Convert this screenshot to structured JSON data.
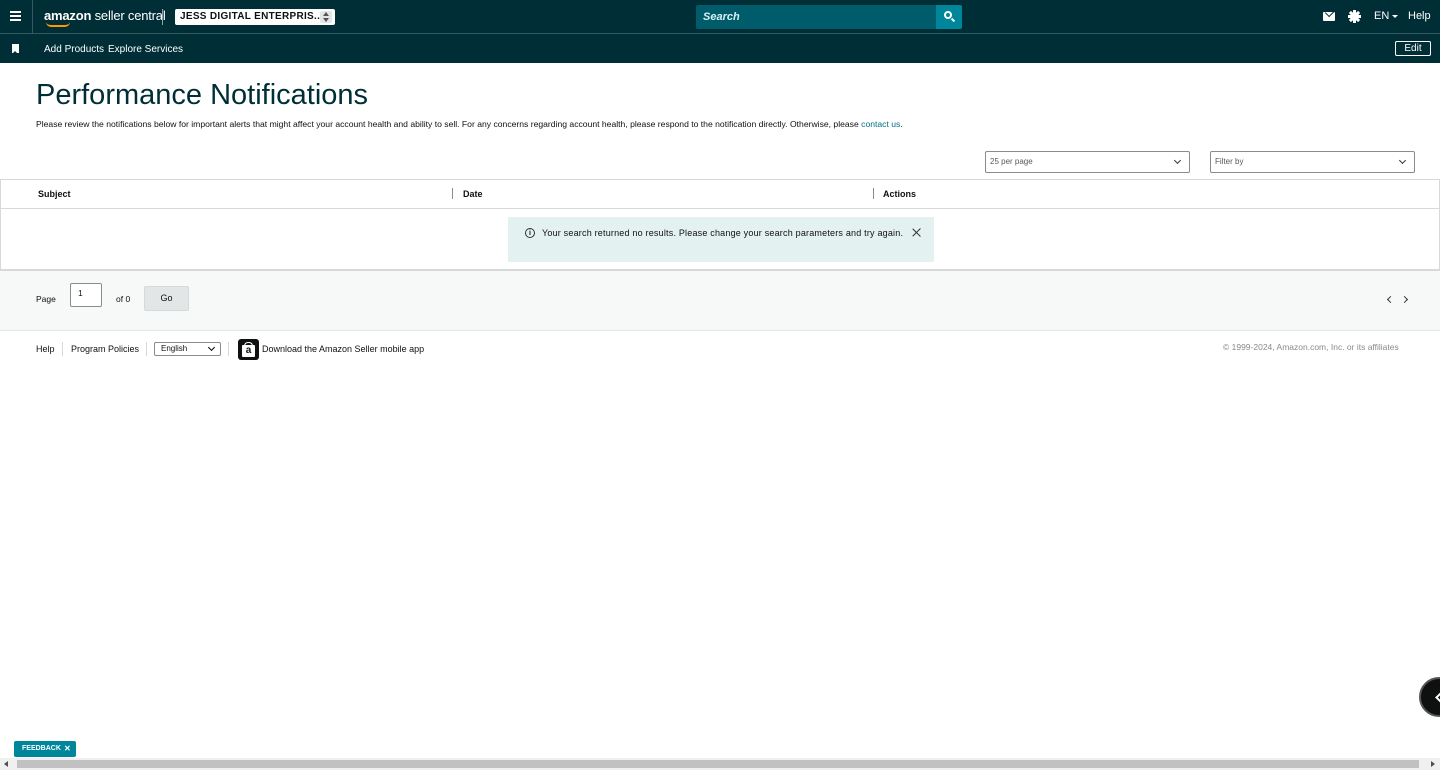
{
  "header": {
    "logo_bold": "amazon",
    "logo_text": "seller central",
    "account_name": "JESS DIGITAL ENTERPRIS...",
    "search_placeholder": "Search",
    "language": "EN",
    "help": "Help"
  },
  "nav": {
    "items": [
      {
        "label": "Add Products"
      },
      {
        "label": "Explore Services"
      }
    ],
    "edit_label": "Edit"
  },
  "page": {
    "title": "Performance Notifications",
    "description": "Please review the notifications below for important alerts that might affect your account health and ability to sell. For any concerns regarding account health, please respond to the notification directly. Otherwise, please ",
    "contact_link": "contact us",
    "description_end": "."
  },
  "controls": {
    "per_page": "25 per page",
    "filter_placeholder": "Filter by"
  },
  "table": {
    "columns": [
      "Subject",
      "Date",
      "Actions"
    ],
    "empty_message": "Your search returned no results. Please change your search parameters and try again."
  },
  "pager": {
    "page_label": "Page",
    "current_page": "1",
    "of_label": "of 0",
    "go_label": "Go"
  },
  "footer": {
    "help": "Help",
    "program_policies": "Program Policies",
    "language": "English",
    "app_download": "Download the Amazon Seller mobile app",
    "copyright": "© 1999-2024, Amazon.com, Inc. or its affiliates"
  },
  "feedback": {
    "label": "FEEDBACK",
    "close": "✕"
  },
  "colors": {
    "header_bg": "#002e36",
    "accent": "#00869a",
    "link": "#007185",
    "alert_bg": "#e3f1f1"
  }
}
